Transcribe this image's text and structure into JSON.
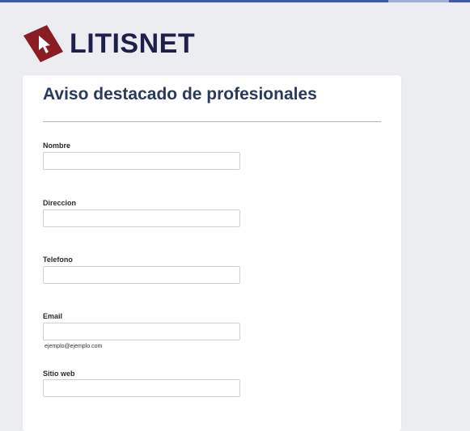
{
  "brand": {
    "name": "LITISNET",
    "color": "#1e1f4b",
    "mark_color": "#8a1c24"
  },
  "form": {
    "title": "Aviso destacado de profesionales",
    "fields": [
      {
        "label": "Nombre",
        "value": "",
        "placeholder": ""
      },
      {
        "label": "Direccion",
        "value": "",
        "placeholder": ""
      },
      {
        "label": "Telefono",
        "value": "",
        "placeholder": ""
      },
      {
        "label": "Email",
        "value": "",
        "placeholder": "",
        "hint": "ejemplo@ejemplo.com"
      },
      {
        "label": "Sitio web",
        "value": "",
        "placeholder": ""
      }
    ]
  }
}
